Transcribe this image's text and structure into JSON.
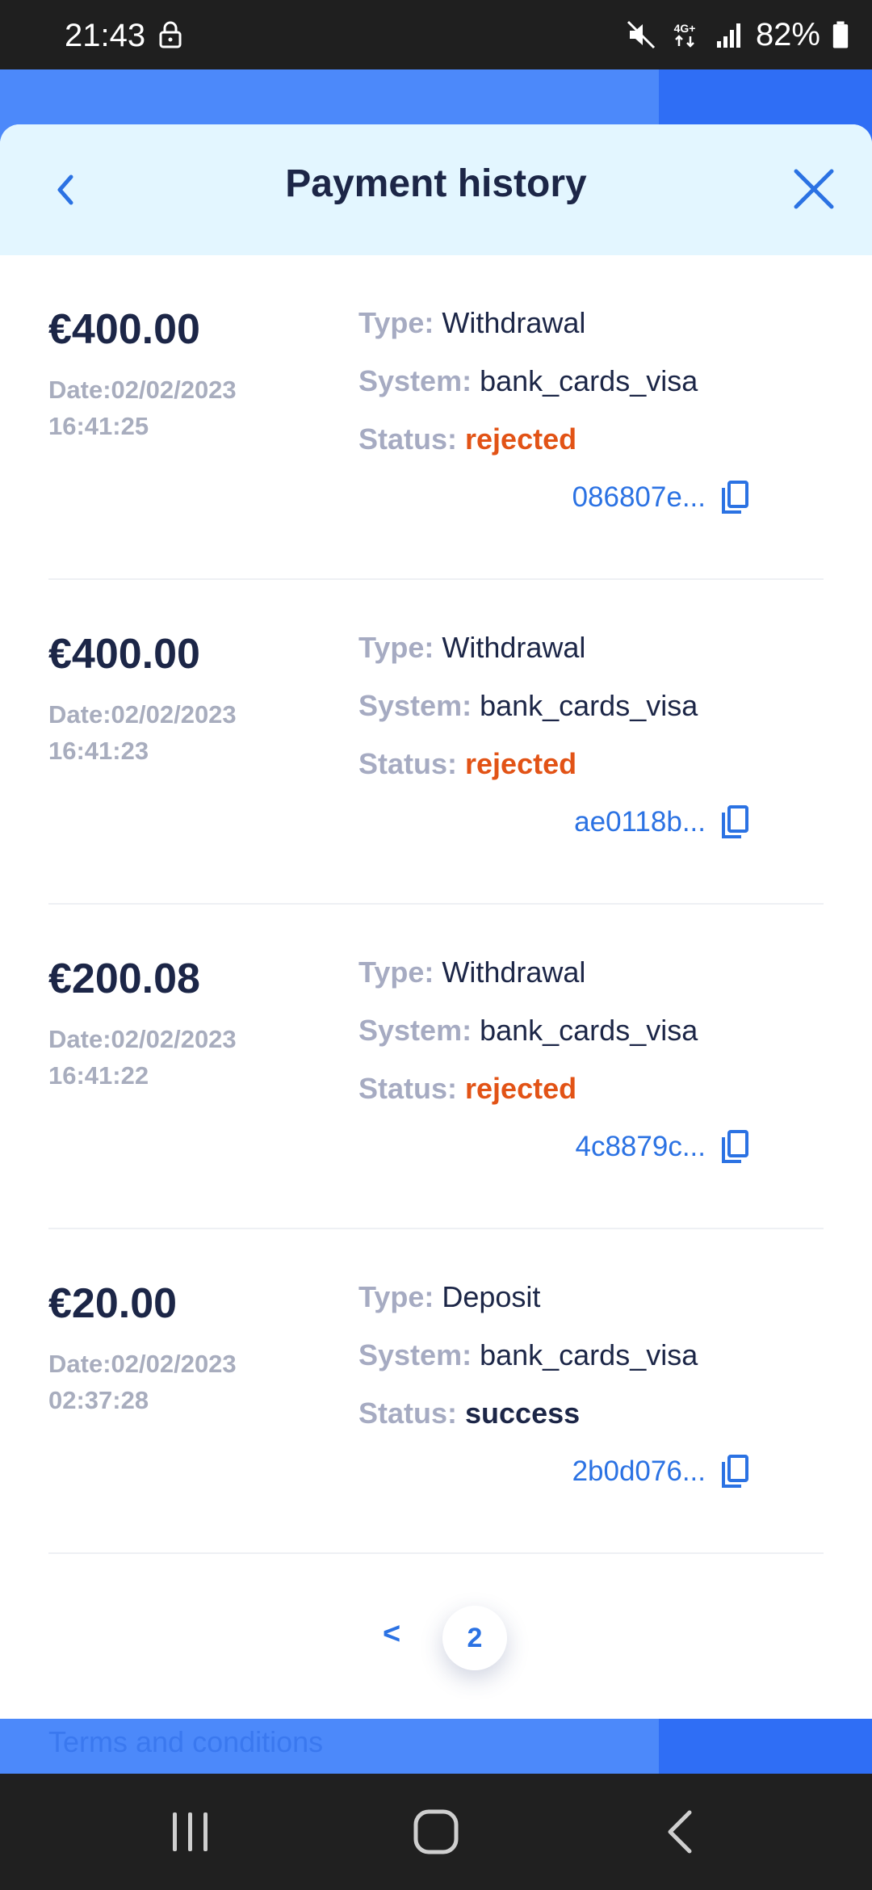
{
  "status_bar": {
    "time": "21:43",
    "battery_percent": "82%",
    "network": "4G+"
  },
  "modal": {
    "title": "Payment history"
  },
  "labels": {
    "type": "Type: ",
    "system": "System: ",
    "status": "Status: "
  },
  "payments": [
    {
      "amount": "€400.00",
      "date": "Date:02/02/2023",
      "time": "16:41:25",
      "type": "Withdrawal",
      "system": "bank_cards_visa",
      "status": "rejected",
      "tx_id": "086807e..."
    },
    {
      "amount": "€400.00",
      "date": "Date:02/02/2023",
      "time": "16:41:23",
      "type": "Withdrawal",
      "system": "bank_cards_visa",
      "status": "rejected",
      "tx_id": "ae0118b..."
    },
    {
      "amount": "€200.08",
      "date": "Date:02/02/2023",
      "time": "16:41:22",
      "type": "Withdrawal",
      "system": "bank_cards_visa",
      "status": "rejected",
      "tx_id": "4c8879c..."
    },
    {
      "amount": "€20.00",
      "date": "Date:02/02/2023",
      "time": "02:37:28",
      "type": "Deposit",
      "system": "bank_cards_visa",
      "status": "success",
      "tx_id": "2b0d076..."
    }
  ],
  "pagination": {
    "prev_label": "<",
    "current_page": "2"
  },
  "footer": {
    "terms_label": "Terms and conditions"
  },
  "colors": {
    "header_bg": "#e3f6ff",
    "accent": "#2b72e3",
    "rejected": "#e25316",
    "text_dark": "#1c2647"
  }
}
